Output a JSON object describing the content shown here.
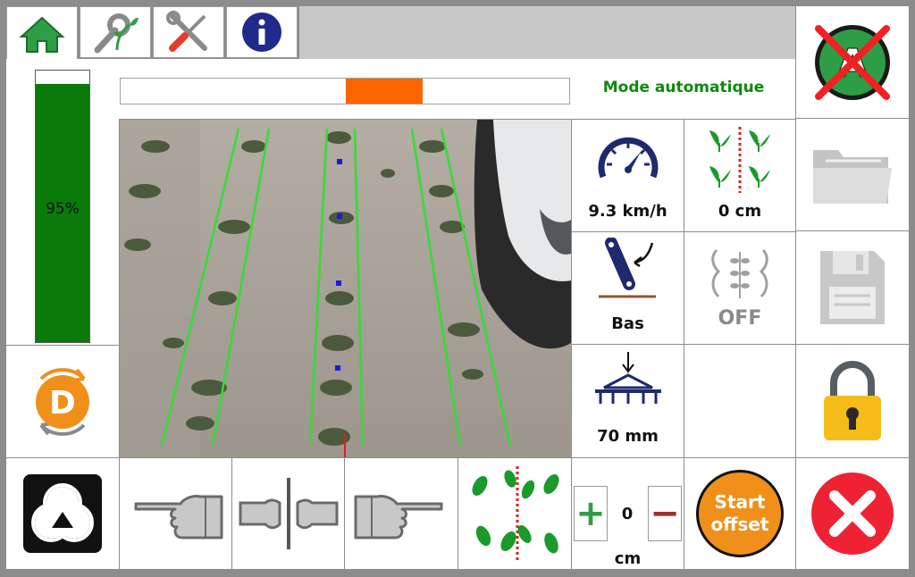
{
  "tabs": [
    {
      "name": "home",
      "icon": "home-icon"
    },
    {
      "name": "tools-plant",
      "icon": "wrench-plant-icon"
    },
    {
      "name": "settings",
      "icon": "wrench-screwdriver-icon"
    },
    {
      "name": "info",
      "icon": "info-icon"
    }
  ],
  "header": {
    "mode_label": "Mode automatique",
    "mode_color": "#0d8a0d"
  },
  "level": {
    "percent_label": "95%",
    "fill_fraction": 0.95,
    "fill_color": "#0a7a0a"
  },
  "status": {
    "speed_label": "9.3 km/h",
    "row_spacing_label": "0 cm",
    "position_label": "Bas",
    "guidance_label": "OFF",
    "depth_label": "70 mm"
  },
  "offset": {
    "value": "0",
    "unit": "cm",
    "plus_label": "+",
    "minus_label": "−",
    "start_label_line1": "Start",
    "start_label_line2": "offset",
    "start_color": "#f0901a"
  },
  "side_buttons": {
    "auto_off": "auto-off-icon",
    "folder": "folder-icon",
    "save": "save-icon",
    "lock": "lock-icon",
    "close": "close-icon"
  },
  "mode_badge": {
    "letter": "D",
    "color": "#f0901a"
  },
  "auto_badge_letter": "A",
  "accent_green": "#2e9e46",
  "accent_orange": "#ff6600"
}
